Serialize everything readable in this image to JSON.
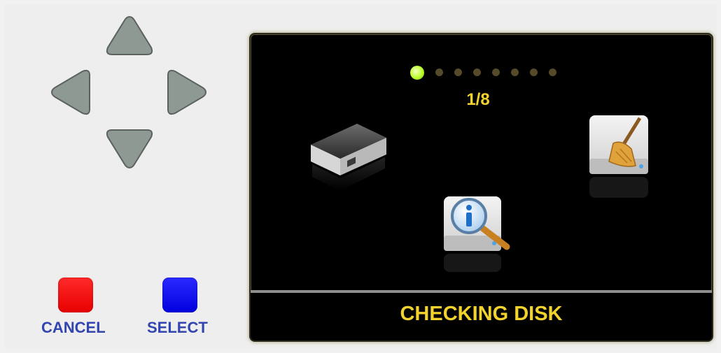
{
  "controls": {
    "cancel_label": "CANCEL",
    "select_label": "SELECT"
  },
  "screen": {
    "page_indicator": {
      "current": 1,
      "total": 8
    },
    "counter_text": "1/8",
    "status_text": "CHECKING DISK",
    "icons": [
      "router-icon",
      "disk-check-icon",
      "disk-cleanup-icon"
    ]
  },
  "colors": {
    "accent_yellow": "#f2d22c",
    "active_dot": "#b8ff28",
    "cancel": "#ff0000",
    "select": "#0000e6",
    "label_blue": "#3345ae"
  }
}
